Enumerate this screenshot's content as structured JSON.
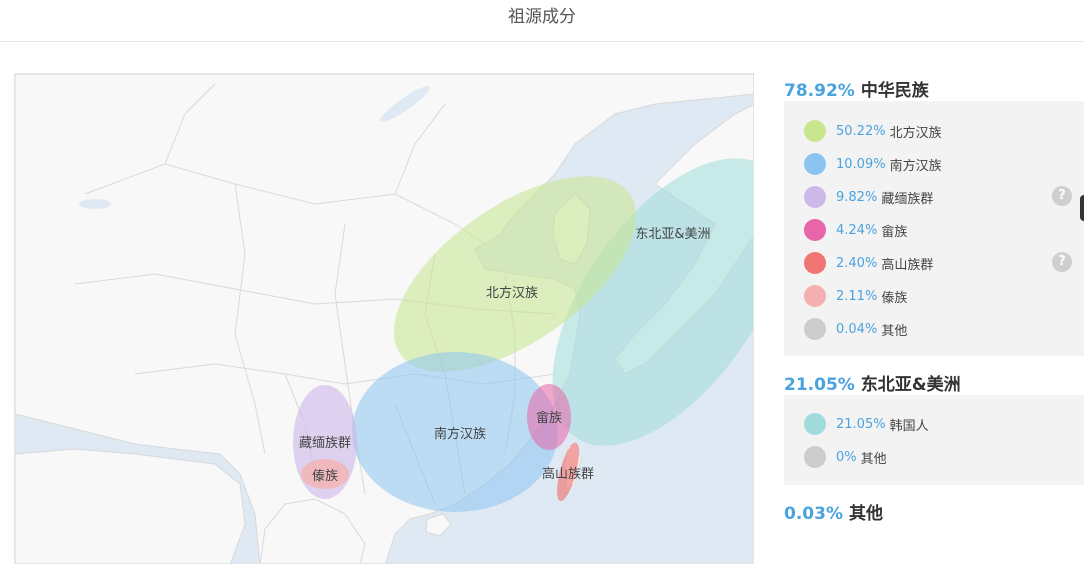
{
  "page": {
    "title": "祖源成分"
  },
  "map": {
    "labels": {
      "northern_han": "北方汉族",
      "southern_han": "南方汉族",
      "tibeto_burman": "藏缅族群",
      "dai": "傣族",
      "she": "畲族",
      "gaoshan": "高山族群",
      "northeast_asia_americas": "东北亚&美洲"
    }
  },
  "groups": [
    {
      "percent": "78.92%",
      "name": "中华民族",
      "items": [
        {
          "percent": "50.22%",
          "name": "北方汉族",
          "color": "#c7e68e",
          "help": false
        },
        {
          "percent": "10.09%",
          "name": "南方汉族",
          "color": "#8bc4f0",
          "help": false
        },
        {
          "percent": "9.82%",
          "name": "藏缅族群",
          "color": "#cdb8ea",
          "help": true
        },
        {
          "percent": "4.24%",
          "name": "畲族",
          "color": "#e765a8",
          "help": false
        },
        {
          "percent": "2.40%",
          "name": "高山族群",
          "color": "#f07573",
          "help": true
        },
        {
          "percent": "2.11%",
          "name": "傣族",
          "color": "#f4b0ae",
          "help": false
        },
        {
          "percent": "0.04%",
          "name": "其他",
          "color": "#cccccc",
          "help": false
        }
      ]
    },
    {
      "percent": "21.05%",
      "name": "东北亚&美洲",
      "items": [
        {
          "percent": "21.05%",
          "name": "韩国人",
          "color": "#9fdcdb",
          "help": false
        },
        {
          "percent": "0%",
          "name": "其他",
          "color": "#cccccc",
          "help": false
        }
      ]
    },
    {
      "percent": "0.03%",
      "name": "其他",
      "items": []
    }
  ],
  "help_symbol": "?"
}
